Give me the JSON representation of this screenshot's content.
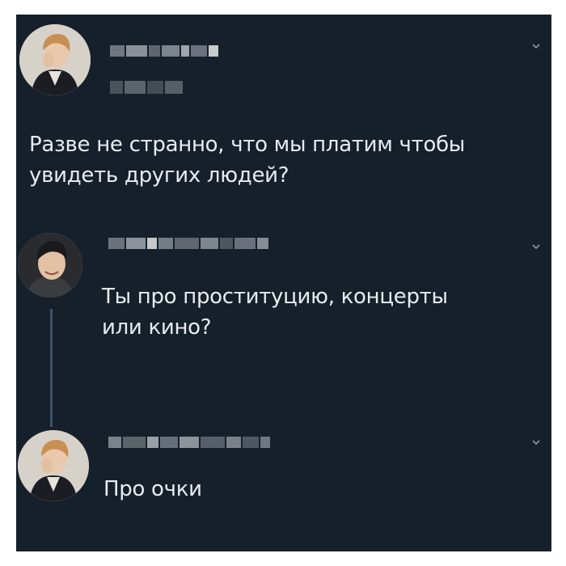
{
  "tweets": [
    {
      "text": "Разве не странно, что мы платим чтобы\nувидеть других людей?",
      "avatar_icon": "user-avatar-icon"
    },
    {
      "text": "Ты про проституцию, концерты\nили кино?",
      "avatar_icon": "user-avatar-icon"
    },
    {
      "text": "Про очки",
      "avatar_icon": "user-avatar-icon"
    }
  ],
  "icons": {
    "more_options": "chevron-down-icon"
  },
  "colors": {
    "background": "#16202a",
    "text": "#e7ecef",
    "muted": "#8899a6",
    "thread": "#3d5466"
  }
}
